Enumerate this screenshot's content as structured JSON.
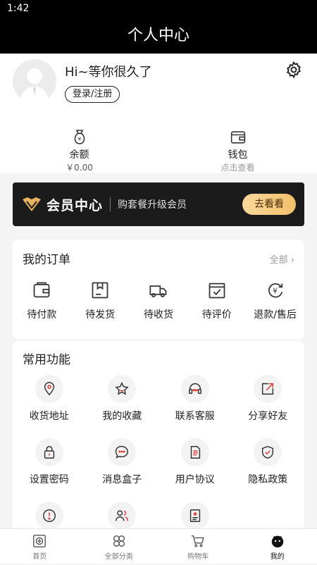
{
  "status": {
    "time": "1:42"
  },
  "header": {
    "title": "个人中心"
  },
  "profile": {
    "greeting": "Hi~等你很久了",
    "login_label": "登录/注册"
  },
  "wallet": {
    "balance_label": "余额",
    "balance_value": "￥0.00",
    "purse_label": "钱包",
    "purse_sub": "点击查看"
  },
  "vip": {
    "title": "会员中心",
    "desc": "购套餐升级会员",
    "button": "去看看"
  },
  "orders": {
    "title": "我的订单",
    "all_label": "全部",
    "items": [
      {
        "label": "待付款",
        "icon": "wallet-icon"
      },
      {
        "label": "待发货",
        "icon": "box-icon"
      },
      {
        "label": "待收货",
        "icon": "truck-icon"
      },
      {
        "label": "待评价",
        "icon": "review-icon"
      },
      {
        "label": "退款/售后",
        "icon": "refund-icon"
      }
    ]
  },
  "functions": {
    "title": "常用功能",
    "items": [
      {
        "label": "收货地址",
        "icon": "location-icon"
      },
      {
        "label": "我的收藏",
        "icon": "star-icon"
      },
      {
        "label": "联系客服",
        "icon": "headset-icon"
      },
      {
        "label": "分享好友",
        "icon": "share-icon"
      },
      {
        "label": "设置密码",
        "icon": "lock-icon"
      },
      {
        "label": "消息盒子",
        "icon": "message-icon"
      },
      {
        "label": "用户协议",
        "icon": "document-icon"
      },
      {
        "label": "隐私政策",
        "icon": "shield-check-icon"
      },
      {
        "label": "",
        "icon": "warning-icon"
      },
      {
        "label": "",
        "icon": "users-icon"
      },
      {
        "label": "",
        "icon": "certificate-icon"
      }
    ]
  },
  "tabbar": {
    "items": [
      {
        "label": "首页",
        "icon": "home-icon"
      },
      {
        "label": "全部分类",
        "icon": "category-icon"
      },
      {
        "label": "购物车",
        "icon": "cart-icon"
      },
      {
        "label": "我的",
        "icon": "profile-icon"
      }
    ],
    "active_index": 3
  },
  "colors": {
    "accent": "#e53935",
    "vip_gold": "#f2c06a",
    "header_bg": "#000000"
  }
}
